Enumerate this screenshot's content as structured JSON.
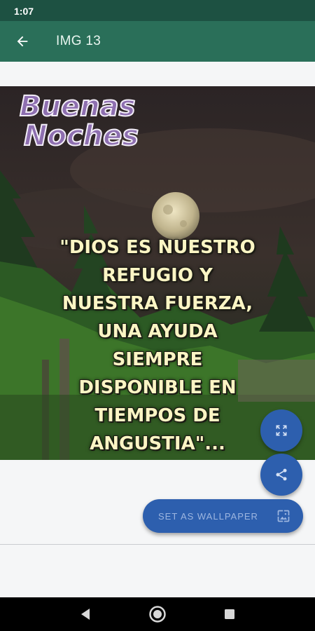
{
  "status_bar": {
    "time": "1:07"
  },
  "app_bar": {
    "title": "IMG 13",
    "back_icon": "arrow-back-icon"
  },
  "image": {
    "greeting_line1": "Buenas",
    "greeting_line2": "Noches",
    "quote": "\"DIOS ES NUESTRO\nREFUGIO Y\nNUESTRA FUERZA,\nUNA AYUDA\nSIEMPRE\nDISPONIBLE EN\nTIEMPOS DE\nANGUSTIA\"..."
  },
  "actions": {
    "fullscreen_icon": "fullscreen-icon",
    "share_icon": "share-icon",
    "wallpaper_label": "SET AS WALLPAPER",
    "wallpaper_icon": "wallpaper-icon"
  },
  "navigation": {
    "back": "nav-back-icon",
    "home": "nav-home-icon",
    "recents": "nav-recents-icon"
  },
  "colors": {
    "status_bar": "#1d5142",
    "app_bar": "#2a6f59",
    "fab": "#2d5fae",
    "quote_text": "#fbf5c4"
  }
}
